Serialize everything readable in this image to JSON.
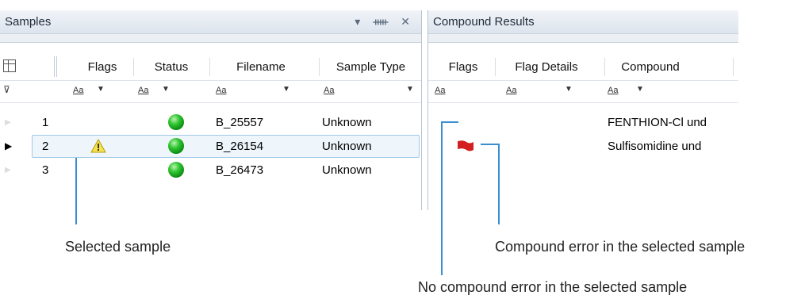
{
  "samples_panel": {
    "title": "Samples",
    "controls": "▾ ⊥ ✕",
    "columns": [
      "Flags",
      "Status",
      "Filename",
      "Sample Type"
    ],
    "filter_glyph": "Aa",
    "rows": [
      {
        "num": "1",
        "flag": "",
        "status": "green",
        "filename": "B_25557",
        "sample_type": "Unknown",
        "current": false
      },
      {
        "num": "2",
        "flag": "warning",
        "status": "green",
        "filename": "B_26154",
        "sample_type": "Unknown",
        "current": true
      },
      {
        "num": "3",
        "flag": "",
        "status": "green",
        "filename": "B_26473",
        "sample_type": "Unknown",
        "current": false
      }
    ]
  },
  "compound_panel": {
    "title": "Compound Results",
    "columns": [
      "Flags",
      "Flag Details",
      "Compound"
    ],
    "filter_glyph": "Aa",
    "rows": [
      {
        "flag": "",
        "compound": "FENTHION-Cl und"
      },
      {
        "flag": "red-flag",
        "compound": "Sulfisomidine und"
      }
    ]
  },
  "callouts": {
    "selected_sample": "Selected sample",
    "compound_error": "Compound error in the selected sample",
    "no_compound_error": "No compound error in the selected sample"
  },
  "colors": {
    "accent": "#3a8fd0",
    "status_ok": "#1aa51a",
    "flag_error": "#d31f1f"
  }
}
